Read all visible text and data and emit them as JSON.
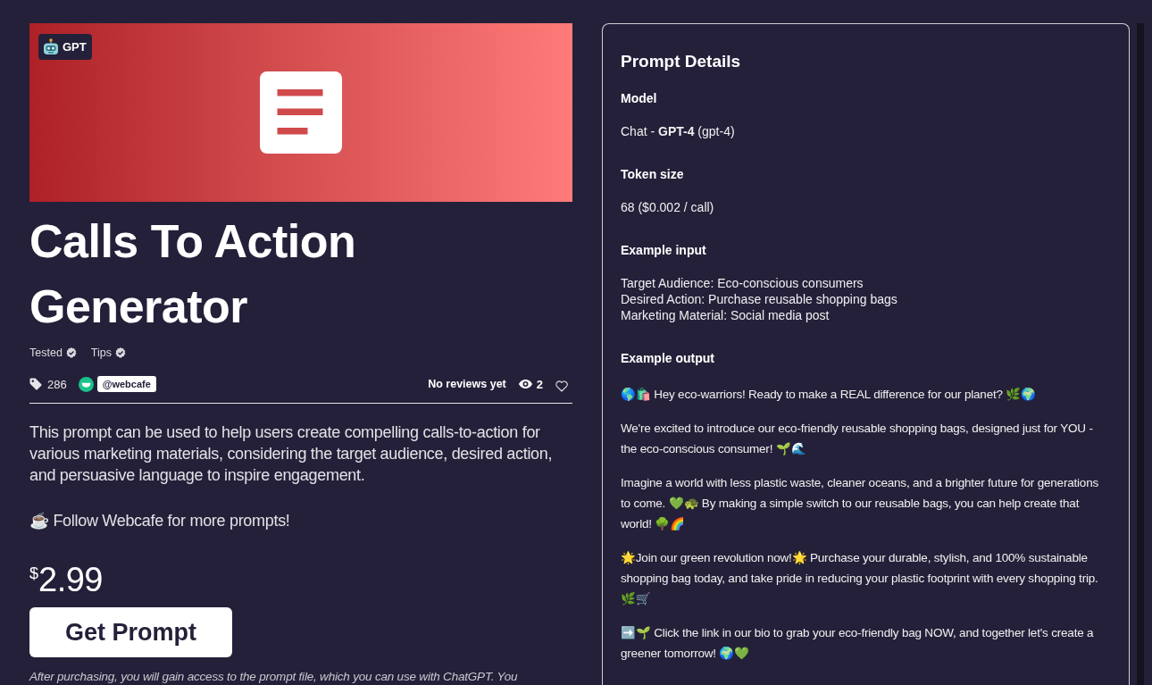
{
  "banner": {
    "badge": "GPT"
  },
  "title": "Calls To Action Generator",
  "tags": [
    {
      "label": "Tested",
      "verified": true
    },
    {
      "label": "Tips",
      "verified": true
    }
  ],
  "stats": {
    "sales": "286",
    "author": "@webcafe",
    "reviews": "No reviews yet",
    "views": "2",
    "favorited": false
  },
  "description": "This prompt can be used to help users create compelling calls-to-action for various marketing materials, considering the target audience, desired action, and persuasive language to inspire engagement.",
  "follow_note": "☕ Follow Webcafe for more prompts!",
  "price": {
    "currency": "$",
    "amount": "2.99"
  },
  "buy_button": "Get Prompt",
  "purchase_note": "After purchasing, you will gain access to the prompt file, which you can use with ChatGPT. You",
  "details": {
    "title": "Prompt Details",
    "sections": [
      {
        "heading": "Model",
        "kind": "plain",
        "paragraphs": [
          "Chat - **GPT-4** (gpt-4)"
        ]
      },
      {
        "heading": "Token size",
        "kind": "plain",
        "paragraphs": [
          "68 ($0.002 / call)"
        ]
      },
      {
        "heading": "Example input",
        "kind": "plain",
        "paragraphs": [
          "Target Audience: Eco-conscious consumers\nDesired Action: Purchase reusable shopping bags\nMarketing Material: Social media post"
        ]
      },
      {
        "heading": "Example output",
        "kind": "message",
        "paragraphs": [
          "🌎🛍️ Hey eco-warriors! Ready to make a REAL difference for our planet? 🌿🌍",
          "We're excited to introduce our eco-friendly reusable shopping bags, designed just for YOU - the eco-conscious consumer! 🌱🌊",
          "Imagine a world with less plastic waste, cleaner oceans, and a brighter future for generations to come. 💚🐢 By making a simple switch to our reusable bags, you can help create that world! 🌳🌈",
          "🌟Join our green revolution now!🌟 Purchase your durable, stylish, and 100% sustainable shopping bag today, and take pride in reducing your plastic footprint with every shopping trip. 🌿🛒",
          "➡️🌱 Click the link in our bio to grab your eco-friendly bag NOW, and together let's create a greener tomorrow! 🌍💚"
        ]
      }
    ]
  }
}
